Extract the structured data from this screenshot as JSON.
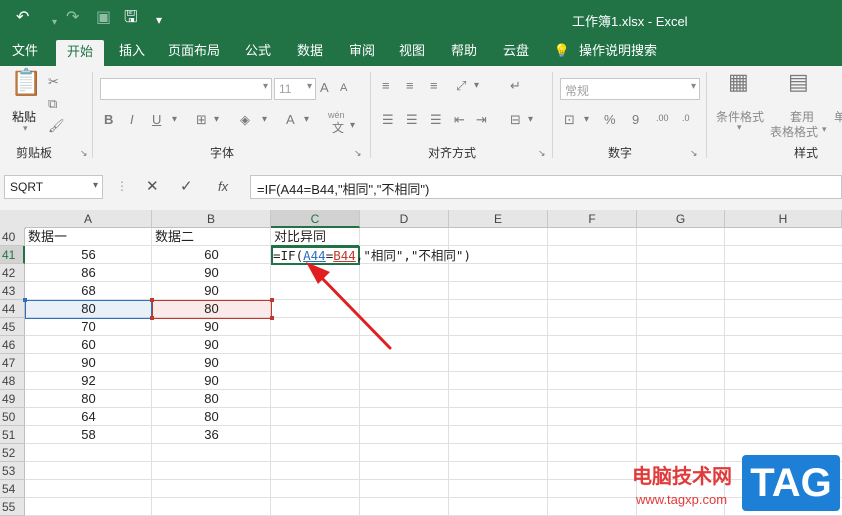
{
  "window": {
    "title": "工作簿1.xlsx  -  Excel"
  },
  "quick_access": {
    "undo": "↶",
    "redo": "↷",
    "save": "🖫",
    "customize": "▾"
  },
  "menu": {
    "tabs": [
      "文件",
      "开始",
      "插入",
      "页面布局",
      "公式",
      "数据",
      "审阅",
      "视图",
      "帮助",
      "云盘",
      "操作说明搜索"
    ],
    "active": "开始",
    "search_icon": "lightbulb-icon"
  },
  "ribbon": {
    "clipboard": {
      "label": "剪贴板",
      "paste_label": "粘贴"
    },
    "font": {
      "label": "字体",
      "font_size": "11",
      "bold": "B",
      "italic": "I",
      "underline": "U",
      "phonetic": "wén"
    },
    "alignment": {
      "label": "对齐方式"
    },
    "number": {
      "label": "数字",
      "format": "常规",
      "percent": "%",
      "comma": "9"
    },
    "styles": {
      "label": "样式",
      "conditional": "条件格式",
      "table_format_1": "套用",
      "table_format_2": "表格格式",
      "cell_styles_partial": "单"
    }
  },
  "formula_bar": {
    "name_box": "SQRT",
    "cancel": "✕",
    "enter": "✓",
    "fx": "fx",
    "formula": "=IF(A44=B44,\"相同\",\"不相同\")"
  },
  "sheet": {
    "columns": [
      "A",
      "B",
      "C",
      "D",
      "E",
      "F",
      "G",
      "H"
    ],
    "selected_column": "C",
    "rows": [
      {
        "num": "40",
        "a": "数据一",
        "b": "数据二",
        "c": "对比异同"
      },
      {
        "num": "41",
        "a": "56",
        "b": "60"
      },
      {
        "num": "42",
        "a": "86",
        "b": "90"
      },
      {
        "num": "43",
        "a": "68",
        "b": "90"
      },
      {
        "num": "44",
        "a": "80",
        "b": "80"
      },
      {
        "num": "45",
        "a": "70",
        "b": "90"
      },
      {
        "num": "46",
        "a": "60",
        "b": "90"
      },
      {
        "num": "47",
        "a": "90",
        "b": "90"
      },
      {
        "num": "48",
        "a": "92",
        "b": "90"
      },
      {
        "num": "49",
        "a": "80",
        "b": "80"
      },
      {
        "num": "50",
        "a": "64",
        "b": "80"
      },
      {
        "num": "51",
        "a": "58",
        "b": "36"
      },
      {
        "num": "52"
      },
      {
        "num": "53"
      },
      {
        "num": "54"
      },
      {
        "num": "55"
      }
    ],
    "selected_row": "41",
    "edit_cell": {
      "prefix": "=IF(",
      "ref1": "A44",
      "eq": "=",
      "ref2": "B44",
      "suffix": ",\"相同\",\"不相同\")"
    }
  },
  "watermark": {
    "text": "电脑技术网",
    "url": "www.tagxp.com",
    "tag": "TAG"
  },
  "colors": {
    "excel_green": "#217346",
    "ref_blue": "#2f6fbf",
    "ref_red": "#c0392b",
    "arrow": "#e02020"
  }
}
